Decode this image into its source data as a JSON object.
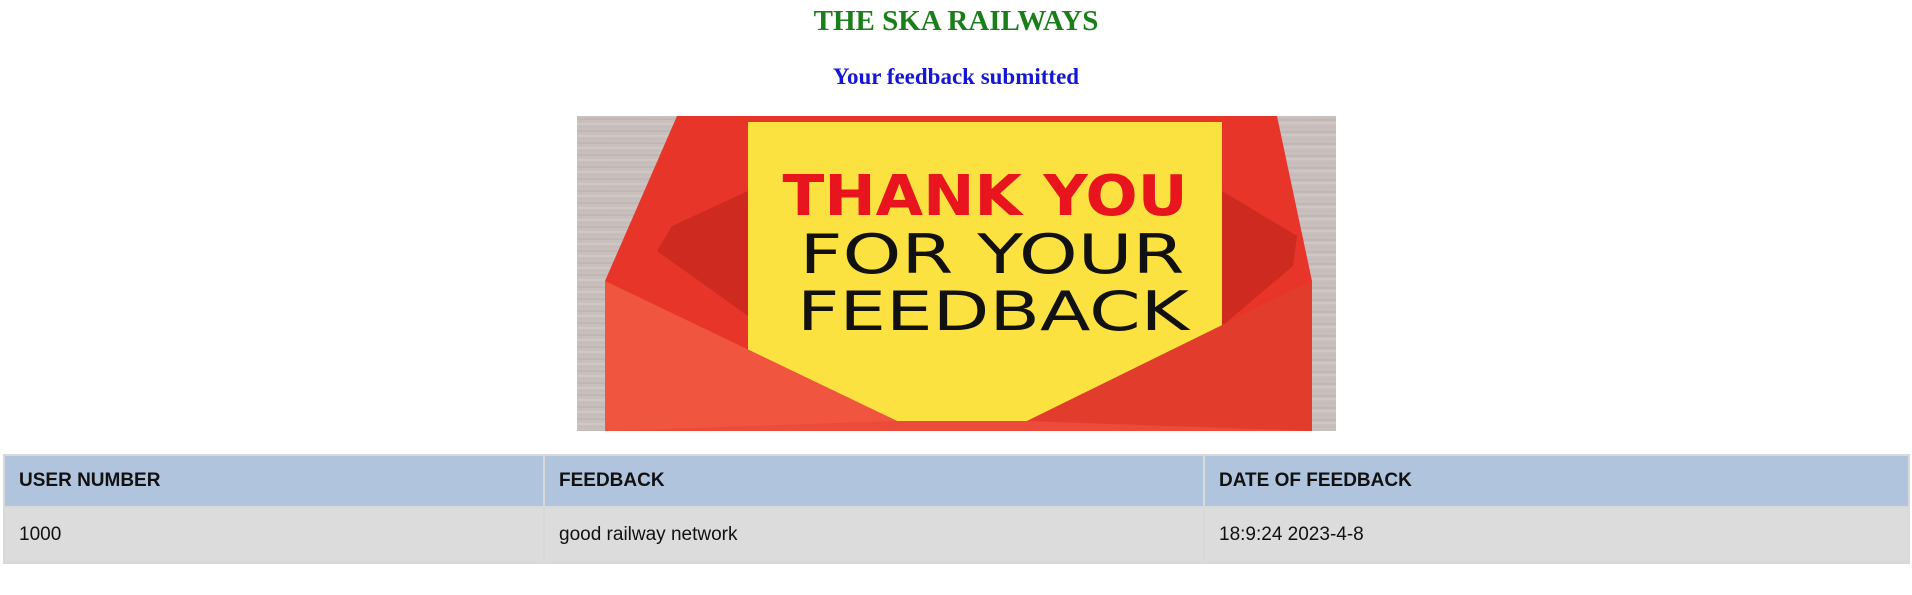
{
  "header": {
    "title": "THE SKA RAILWAYS",
    "subtitle": "Your feedback submitted"
  },
  "thank_you_image": {
    "line1": "THANK YOU",
    "line2": "FOR YOUR",
    "line3": "FEEDBACK",
    "colors": {
      "wood_background": "#c8bfbc",
      "card": "#fbe241",
      "envelope": "#e8352a",
      "headline_text": "#e8141e",
      "body_text": "#111111"
    }
  },
  "table": {
    "headers": [
      "USER NUMBER",
      "FEEDBACK",
      "DATE OF FEEDBACK"
    ],
    "rows": [
      [
        "1000",
        "good railway network",
        "18:9:24 2023-4-8"
      ]
    ]
  },
  "colors": {
    "title": "#1a7f1a",
    "subtitle": "#1616d6",
    "table_header_bg": "#b0c4de",
    "table_row_bg": "#dcdcdc"
  }
}
